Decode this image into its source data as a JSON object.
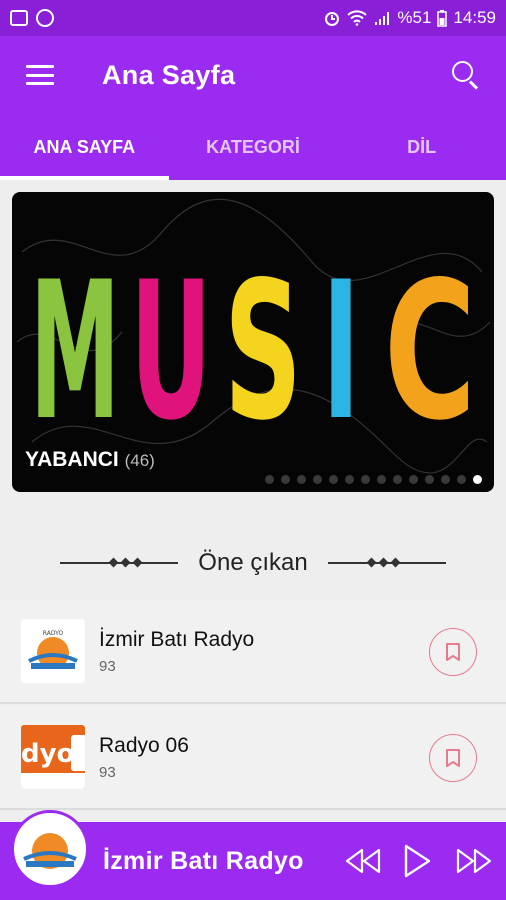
{
  "status": {
    "battery": "%51",
    "time": "14:59"
  },
  "appbar": {
    "title": "Ana Sayfa"
  },
  "tabs": [
    {
      "label": "ANA SAYFA"
    },
    {
      "label": "KATEGORİ"
    },
    {
      "label": "DİL"
    }
  ],
  "banner": {
    "art_text": "MUSIC",
    "label": "YABANCI",
    "count": "(46)",
    "dots": 14,
    "active_dot": 13
  },
  "section": {
    "title": "Öne çıkan"
  },
  "items": [
    {
      "name": "İzmir Batı Radyo",
      "count": "93"
    },
    {
      "name": "Radyo 06",
      "count": "93",
      "logo_text": "dyo"
    }
  ],
  "player": {
    "station": "İzmir Batı Radyo"
  },
  "colors": {
    "primary": "#9b2bf0",
    "status_bar": "#8a1fd8",
    "bookmark": "#e57c8e"
  }
}
